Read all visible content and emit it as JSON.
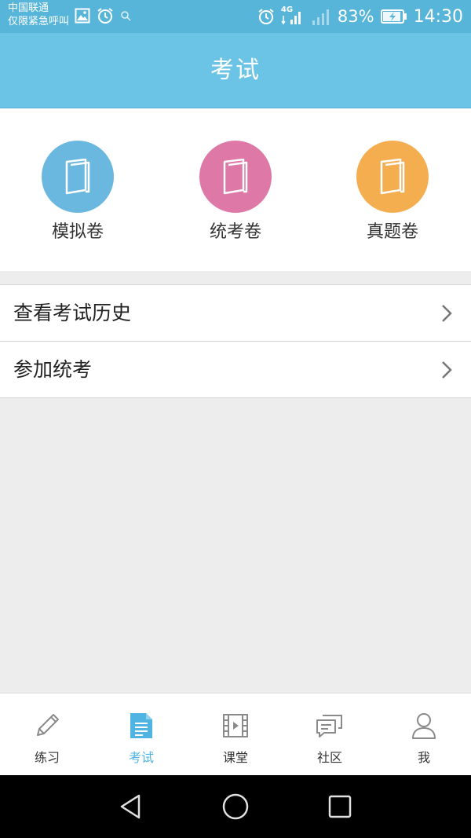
{
  "statusbar": {
    "carrier_line1": "中国联通",
    "carrier_line2": "仅限紧急呼叫",
    "network": "4G",
    "battery": "83%",
    "time": "14:30"
  },
  "header": {
    "title": "考试"
  },
  "categories": [
    {
      "label": "模拟卷",
      "color": "#6ab8e0",
      "icon": "book-icon"
    },
    {
      "label": "统考卷",
      "color": "#de78a7",
      "icon": "book-icon"
    },
    {
      "label": "真题卷",
      "color": "#f4ae50",
      "icon": "book-icon"
    }
  ],
  "list": [
    {
      "label": "查看考试历史"
    },
    {
      "label": "参加统考"
    }
  ],
  "tabs": [
    {
      "label": "练习",
      "icon": "pencil-icon",
      "active": false
    },
    {
      "label": "考试",
      "icon": "document-icon",
      "active": true
    },
    {
      "label": "课堂",
      "icon": "video-icon",
      "active": false
    },
    {
      "label": "社区",
      "icon": "chat-icon",
      "active": false
    },
    {
      "label": "我",
      "icon": "person-icon",
      "active": false
    }
  ],
  "colors": {
    "accent": "#6bc3e6",
    "statusbar": "#56b5d8",
    "tab_active": "#4fb4e2",
    "tab_inactive": "#8a8a8a"
  }
}
